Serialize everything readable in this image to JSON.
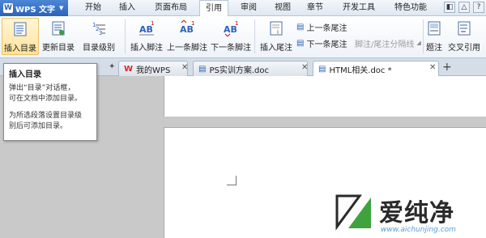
{
  "app": {
    "name": "WPS 文字",
    "logo_letter": "W"
  },
  "menu": [
    "开始",
    "插入",
    "页面布局",
    "引用",
    "审阅",
    "视图",
    "章节",
    "开发工具",
    "特色功能"
  ],
  "ribbon": {
    "insert_toc": "插入目录",
    "update_toc": "更新目录",
    "toc_level": "目录级别",
    "insert_footnote": "插入脚注",
    "prev_footnote": "上一条脚注",
    "next_footnote": "下一条脚注",
    "insert_endnote": "插入尾注",
    "prev_endnote": "上一条尾注",
    "next_endnote": "下一条尾注",
    "footnote_separator": "脚注/尾注分隔线",
    "caption": "题注",
    "cross_reference": "交叉引用"
  },
  "tabs": [
    {
      "label": "我的WPS"
    },
    {
      "label": "PS实训方案.doc"
    },
    {
      "label": "HTML相关.doc *"
    }
  ],
  "tooltip": {
    "title": "插入目录",
    "line1": "弹出“目录”对话框，",
    "line2": "可在文档中添加目录。",
    "line3": "为所选段落设置目录级",
    "line4": "别后可添加目录。"
  },
  "watermark": {
    "text": "爱纯净",
    "url": "www.aichunjing.com"
  },
  "colors": {
    "accent": "#2c63b8",
    "hover": "#ffe39a",
    "watermark_url": "#5a9bd6"
  }
}
